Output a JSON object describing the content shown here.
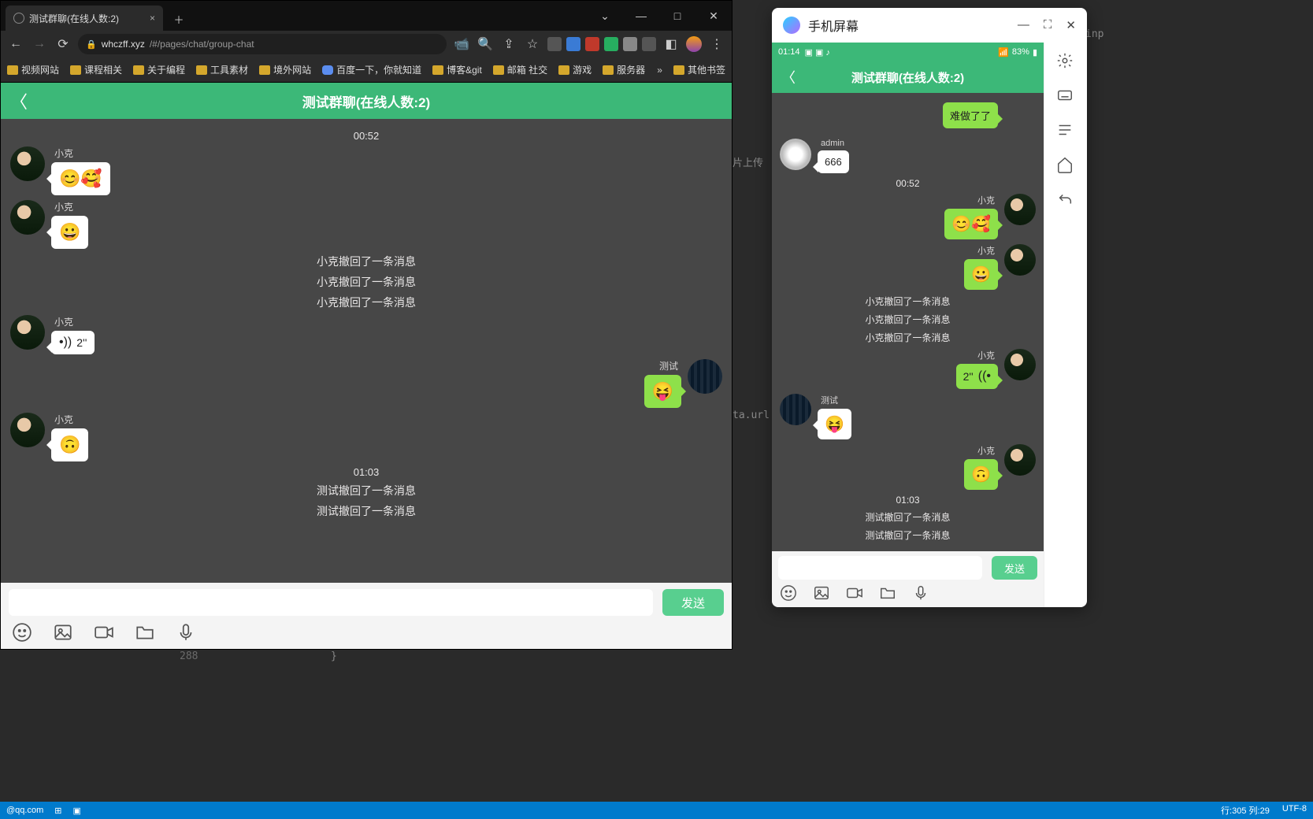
{
  "browser": {
    "tab_title": "测试群聊(在线人数:2)",
    "url_host": "whczff.xyz",
    "url_path": "/#/pages/chat/group-chat",
    "bookmarks": [
      "视频网站",
      "课程相关",
      "关于编程",
      "工具素材",
      "境外网站",
      "百度一下，你就知道",
      "博客&git",
      "邮箱 社交",
      "游戏",
      "服务器"
    ],
    "bookmark_more": "»",
    "bookmark_other": "其他书签"
  },
  "chat_left": {
    "title": "测试群聊(在线人数:2)",
    "send": "发送",
    "items": [
      {
        "type": "time",
        "text": "00:52"
      },
      {
        "type": "msg",
        "side": "left",
        "sender": "小克",
        "avatar": "xk",
        "kind": "emoji",
        "text": "😊🥰"
      },
      {
        "type": "msg",
        "side": "left",
        "sender": "小克",
        "avatar": "xk",
        "kind": "emoji",
        "text": "😀"
      },
      {
        "type": "sys",
        "text": "小克撤回了一条消息"
      },
      {
        "type": "sys",
        "text": "小克撤回了一条消息"
      },
      {
        "type": "sys",
        "text": "小克撤回了一条消息"
      },
      {
        "type": "msg",
        "side": "left",
        "sender": "小克",
        "avatar": "xk",
        "kind": "voice",
        "text": "2''"
      },
      {
        "type": "msg",
        "side": "right",
        "sender": "测试",
        "avatar": "test",
        "kind": "emoji",
        "text": "😝"
      },
      {
        "type": "msg",
        "side": "left",
        "sender": "小克",
        "avatar": "xk",
        "kind": "emoji",
        "text": "🙃"
      },
      {
        "type": "time",
        "text": "01:03"
      },
      {
        "type": "sys",
        "text": "测试撤回了一条消息"
      },
      {
        "type": "sys",
        "text": "测试撤回了一条消息"
      }
    ]
  },
  "phone": {
    "window_title": "手机屏幕",
    "status_time": "01:14",
    "status_battery": "83%",
    "chat_title": "测试群聊(在线人数:2)",
    "send": "发送",
    "items": [
      {
        "type": "msg",
        "side": "right",
        "sender": "",
        "avatar": "",
        "kind": "text",
        "text": "难做了了"
      },
      {
        "type": "msg",
        "side": "left",
        "sender": "admin",
        "avatar": "adm",
        "kind": "text",
        "text": "666"
      },
      {
        "type": "time",
        "text": "00:52"
      },
      {
        "type": "msg",
        "side": "right",
        "sender": "小克",
        "avatar": "xk",
        "kind": "emoji",
        "text": "😊🥰"
      },
      {
        "type": "msg",
        "side": "right",
        "sender": "小克",
        "avatar": "xk",
        "kind": "emoji",
        "text": "😀"
      },
      {
        "type": "sys",
        "text": "小克撤回了一条消息"
      },
      {
        "type": "sys",
        "text": "小克撤回了一条消息"
      },
      {
        "type": "sys",
        "text": "小克撤回了一条消息"
      },
      {
        "type": "msg",
        "side": "right",
        "sender": "小克",
        "avatar": "xk",
        "kind": "voice",
        "text": "2''"
      },
      {
        "type": "msg",
        "side": "left",
        "sender": "测试",
        "avatar": "test",
        "kind": "emoji",
        "text": "😝"
      },
      {
        "type": "msg",
        "side": "right",
        "sender": "小克",
        "avatar": "xk",
        "kind": "emoji",
        "text": "🙃"
      },
      {
        "type": "time",
        "text": "01:03"
      },
      {
        "type": "sys",
        "text": "测试撤回了一条消息"
      },
      {
        "type": "sys",
        "text": "测试撤回了一条消息"
      }
    ]
  },
  "bg": {
    "snippet1": "片上传",
    "snippet2": "ta.url",
    "snippet3": "288",
    "snippet4": "}",
    "snippet5": "@qq.com",
    "snippet6": "inp",
    "status_line": "行:305  列:29",
    "status_enc": "UTF-8"
  }
}
